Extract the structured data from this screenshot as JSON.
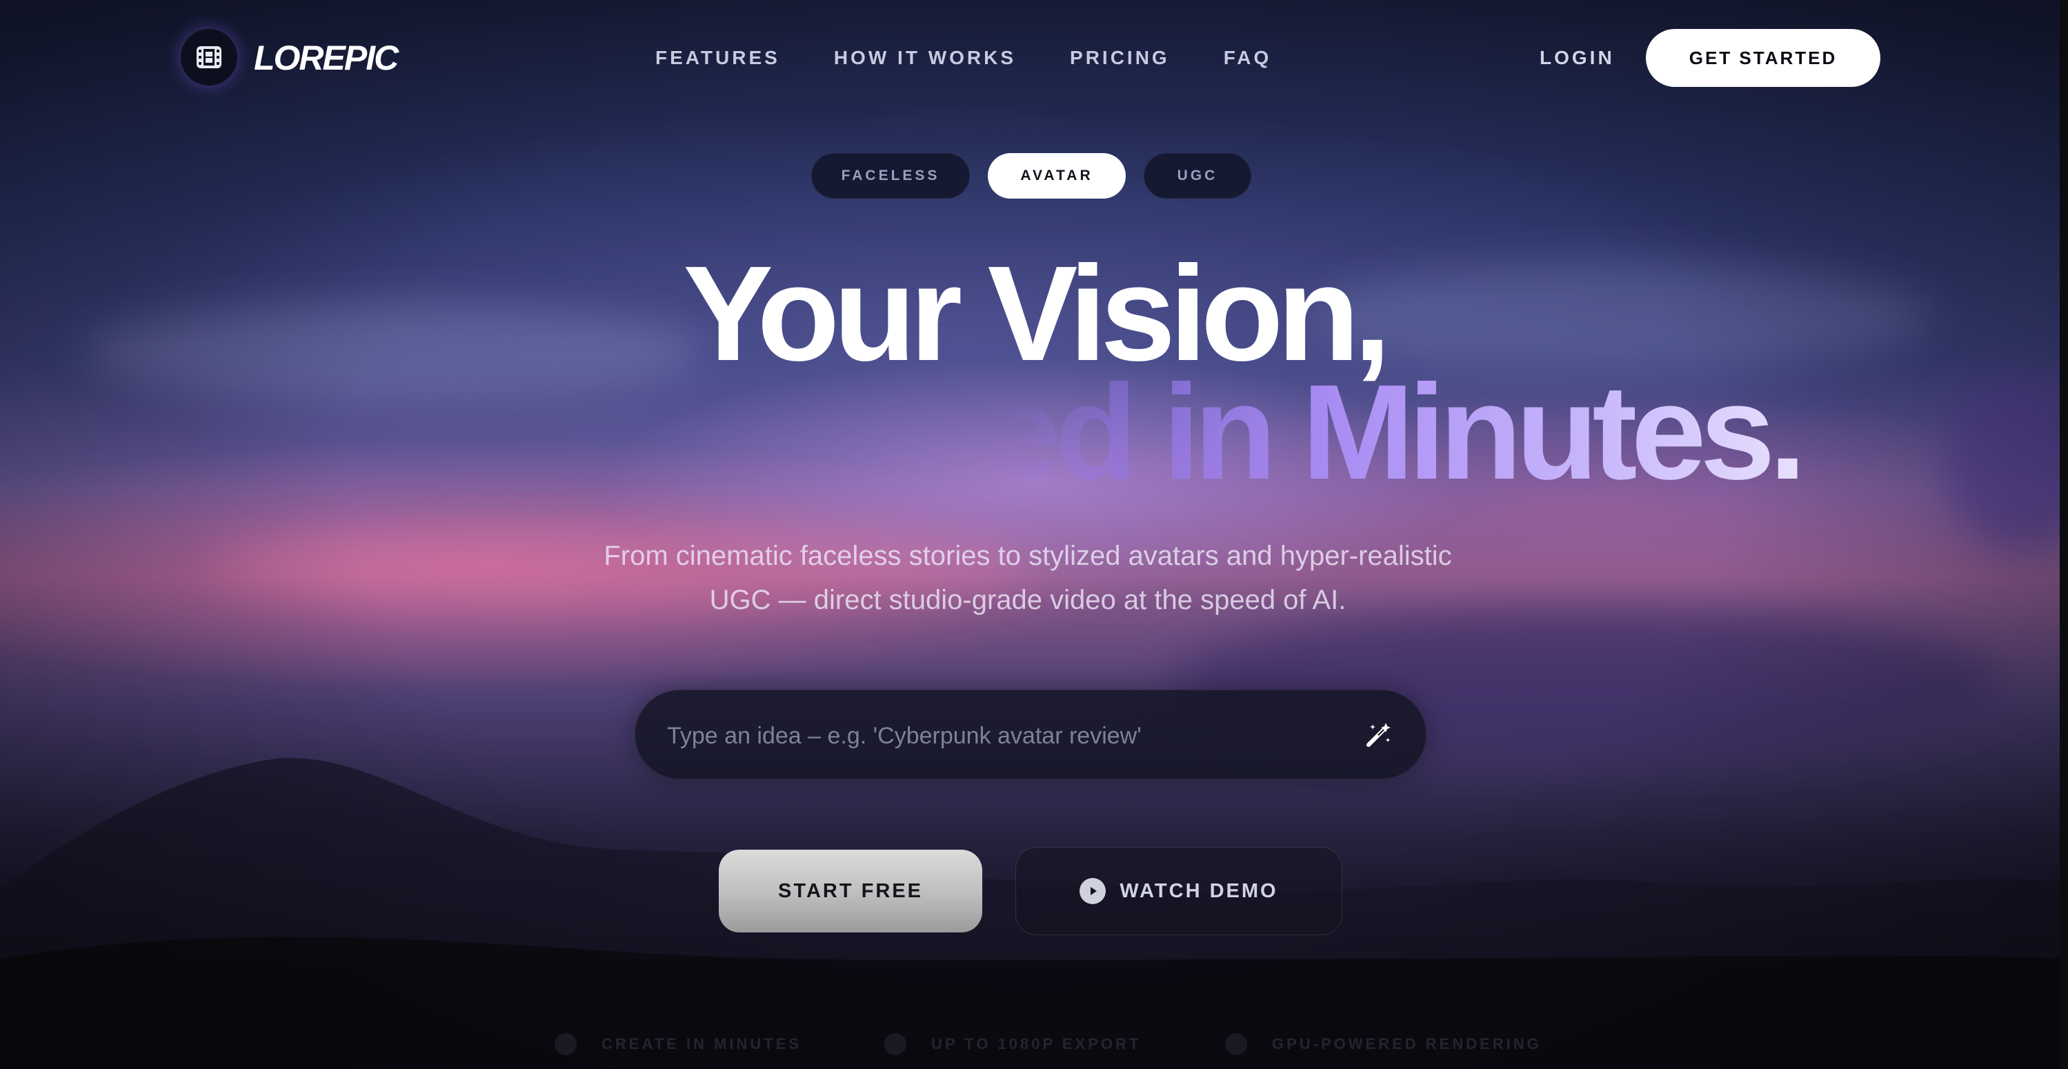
{
  "brand": {
    "name": "LOREPIC"
  },
  "nav": {
    "links": [
      "FEATURES",
      "HOW IT WORKS",
      "PRICING",
      "FAQ"
    ],
    "login": "LOGIN",
    "cta": "GET STARTED"
  },
  "tabs": [
    {
      "label": "FACELESS",
      "active": false
    },
    {
      "label": "AVATAR",
      "active": true
    },
    {
      "label": "UGC",
      "active": false
    }
  ],
  "hero": {
    "headline_line1": "Your Vision,",
    "headline_line2": "Rendered in Minutes.",
    "subtitle_line1": "From cinematic faceless stories to stylized avatars and hyper-realistic",
    "subtitle_line2": "UGC — direct studio-grade video at the speed of AI."
  },
  "prompt": {
    "placeholder": "Type an idea – e.g. 'Cyberpunk avatar review'",
    "value": "",
    "action_icon": "magic-wand-icon"
  },
  "buttons": {
    "start": "START FREE",
    "demo": "WATCH DEMO"
  },
  "features": [
    "CREATE IN MINUTES",
    "UP TO 1080P EXPORT",
    "GPU-POWERED RENDERING"
  ],
  "colors": {
    "accent_purple": "#a98cf3",
    "cta_white": "#ffffff",
    "sky_dark": "#171c38"
  }
}
